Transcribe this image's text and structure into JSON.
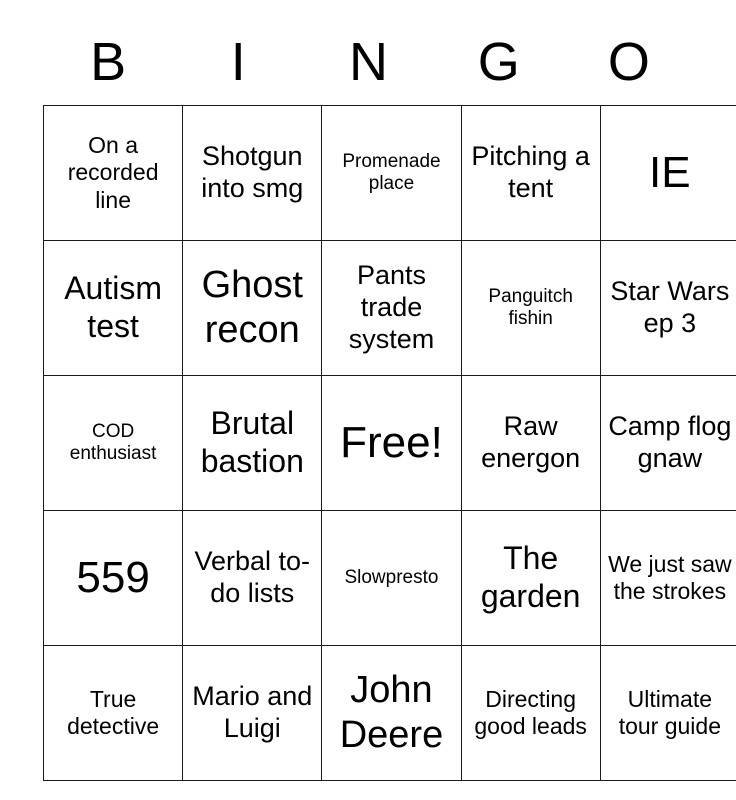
{
  "card": {
    "headers": [
      "B",
      "I",
      "N",
      "G",
      "O"
    ],
    "rows": [
      [
        {
          "text": "On a recorded line",
          "size": "small"
        },
        {
          "text": "Shotgun into smg",
          "size": "medium"
        },
        {
          "text": "Promenade place",
          "size": "xsmall"
        },
        {
          "text": "Pitching a tent",
          "size": "medium"
        },
        {
          "text": "IE",
          "size": "huge"
        }
      ],
      [
        {
          "text": "Autism test",
          "size": "large"
        },
        {
          "text": "Ghost recon",
          "size": "xlarge"
        },
        {
          "text": "Pants trade system",
          "size": "medium"
        },
        {
          "text": "Panguitch fishin",
          "size": "xsmall"
        },
        {
          "text": "Star Wars ep 3",
          "size": "medium"
        }
      ],
      [
        {
          "text": "COD enthusiast",
          "size": "xsmall"
        },
        {
          "text": "Brutal bastion",
          "size": "large"
        },
        {
          "text": "Free!",
          "size": "huge"
        },
        {
          "text": "Raw energon",
          "size": "medium"
        },
        {
          "text": "Camp flog gnaw",
          "size": "medium"
        }
      ],
      [
        {
          "text": "559",
          "size": "huge"
        },
        {
          "text": "Verbal to-do lists",
          "size": "medium"
        },
        {
          "text": "Slowpresto",
          "size": "xsmall"
        },
        {
          "text": "The garden",
          "size": "large"
        },
        {
          "text": "We just saw the strokes",
          "size": "small"
        }
      ],
      [
        {
          "text": "True detective",
          "size": "small"
        },
        {
          "text": "Mario and Luigi",
          "size": "medium"
        },
        {
          "text": "John Deere",
          "size": "xlarge"
        },
        {
          "text": "Directing good leads",
          "size": "small"
        },
        {
          "text": "Ultimate tour guide",
          "size": "small"
        }
      ]
    ]
  },
  "colors": {
    "background": "#ffffff",
    "text": "#000000",
    "border": "#1a1a1a"
  }
}
